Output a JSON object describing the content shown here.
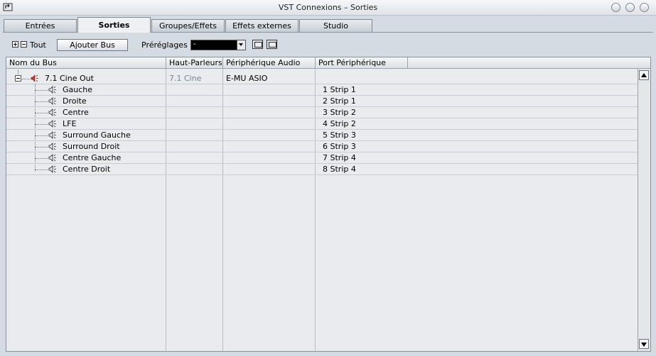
{
  "window": {
    "title": "VST Connexions – Sorties"
  },
  "tabs": [
    {
      "label": "Entrées"
    },
    {
      "label": "Sorties",
      "active": true
    },
    {
      "label": "Groupes/Effets"
    },
    {
      "label": "Effets externes"
    },
    {
      "label": "Studio"
    }
  ],
  "toolbar": {
    "all_label": "Tout",
    "add_bus_label": "Ajouter Bus",
    "presets_label": "Préréglages",
    "presets_value": "-"
  },
  "table": {
    "columns": [
      "Nom du Bus",
      "Haut-Parleurs",
      "Périphérique Audio",
      "Port Périphérique"
    ],
    "bus": {
      "name": "7.1 Cine Out",
      "speakers": "7.1 Cine",
      "device": "E-MU ASIO"
    },
    "channels": [
      {
        "name": "Gauche",
        "port": "1 Strip 1"
      },
      {
        "name": "Droite",
        "port": "2 Strip 1"
      },
      {
        "name": "Centre",
        "port": "3 Strip 2"
      },
      {
        "name": "LFE",
        "port": "4 Strip 2"
      },
      {
        "name": "Surround Gauche",
        "port": "5 Strip 3"
      },
      {
        "name": "Surround Droit",
        "port": "6 Strip 3"
      },
      {
        "name": "Centre Gauche",
        "port": "7 Strip 4"
      },
      {
        "name": "Centre Droit",
        "port": "8 Strip 4"
      }
    ]
  },
  "colors": {
    "bus_icon": "#c0392b",
    "window_bg": "#d5dbe2"
  }
}
